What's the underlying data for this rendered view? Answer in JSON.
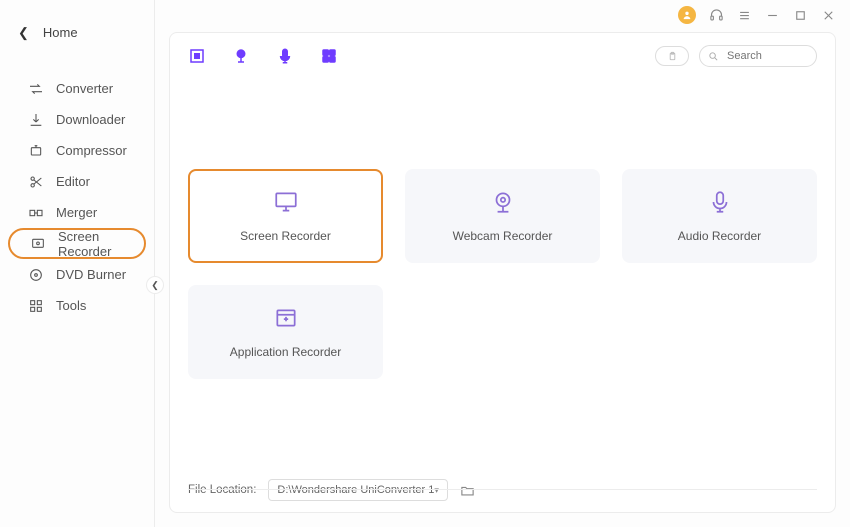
{
  "header": {
    "home_label": "Home"
  },
  "sidebar": {
    "items": [
      {
        "label": "Converter"
      },
      {
        "label": "Downloader"
      },
      {
        "label": "Compressor"
      },
      {
        "label": "Editor"
      },
      {
        "label": "Merger"
      },
      {
        "label": "Screen Recorder"
      },
      {
        "label": "DVD Burner"
      },
      {
        "label": "Tools"
      }
    ]
  },
  "search": {
    "placeholder": "Search"
  },
  "cards": {
    "screen": "Screen Recorder",
    "webcam": "Webcam Recorder",
    "audio": "Audio Recorder",
    "app": "Application Recorder"
  },
  "footer": {
    "label": "File Location:",
    "path": "D:\\Wondershare UniConverter 1"
  }
}
